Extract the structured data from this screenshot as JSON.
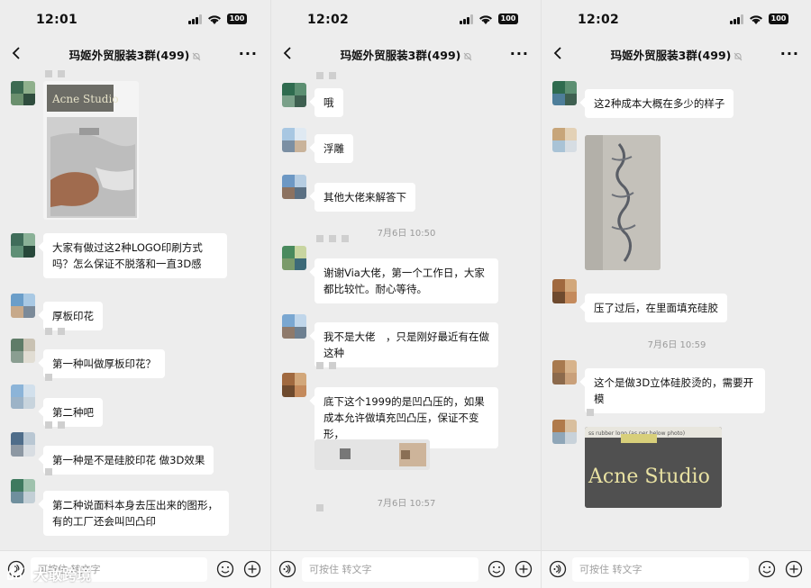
{
  "screens": [
    {
      "time": "12:01",
      "battery": "100",
      "chat_title": "玛姬外贸服装3群(499)",
      "input_placeholder": "可按住 转文字",
      "messages": [
        {
          "type": "image",
          "label": "Acne Studio"
        },
        {
          "type": "text",
          "text": "大家有做过这2种LOGO印刷方式吗？怎么保证不脱落和一直3D感"
        },
        {
          "type": "text",
          "text": "厚板印花"
        },
        {
          "type": "text",
          "text": "第一种叫做厚板印花？"
        },
        {
          "type": "text",
          "text": "第二种吧"
        },
        {
          "type": "text",
          "text": "第一种是不是硅胶印花 做3D效果"
        },
        {
          "type": "text",
          "text": "第二种说面料本身去压出来的图形，有的工厂还会叫凹凸印"
        }
      ]
    },
    {
      "time": "12:02",
      "battery": "100",
      "chat_title": "玛姬外贸服装3群(499)",
      "input_placeholder": "可按住 转文字",
      "messages": [
        {
          "type": "text",
          "text": "哦"
        },
        {
          "type": "text",
          "text": "浮雕"
        },
        {
          "type": "text",
          "text": "其他大佬来解答下"
        },
        {
          "type": "time",
          "text": "7月6日 10:50"
        },
        {
          "type": "text",
          "text": "谢谢Via大佬，第一个工作日，大家都比较忙。耐心等待。"
        },
        {
          "type": "text",
          "text": "我不是大佬　，只是刚好最近有在做这种"
        },
        {
          "type": "text",
          "text": "底下这个1999的是凹凸压的，如果成本允许做填充凹凸压，保证不变形，"
        },
        {
          "type": "time",
          "text": "7月6日 10:57"
        }
      ]
    },
    {
      "time": "12:02",
      "battery": "100",
      "chat_title": "玛姬外贸服装3群(499)",
      "input_placeholder": "可按住 转文字",
      "messages": [
        {
          "type": "text",
          "text": "这2种成本大概在多少的样子"
        },
        {
          "type": "image",
          "label": ""
        },
        {
          "type": "text",
          "text": "压了过后，在里面填充硅胶"
        },
        {
          "type": "time",
          "text": "7月6日 10:59"
        },
        {
          "type": "text",
          "text": "这个是做3D立体硅胶烫的，需要开模"
        },
        {
          "type": "image",
          "label": "Acne Studio",
          "caption": "ss rubber logo (as per below photo)"
        }
      ]
    }
  ],
  "watermark": "大敢跨境",
  "colors": {
    "background": "#ededed",
    "bubble": "#ffffff",
    "timestamp": "#9a9a9a"
  }
}
